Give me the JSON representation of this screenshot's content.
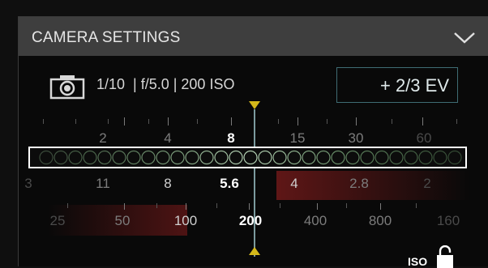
{
  "panel": {
    "title": "CAMERA SETTINGS",
    "collapse_icon": "chevron-down-icon"
  },
  "exposure": {
    "camera_icon": "camera-icon",
    "summary": "1/10  | f/5.0 | 200 ISO",
    "ev_value": "+ 2/3 EV"
  },
  "shutter_scale": {
    "labels": [
      "2",
      "4",
      "8",
      "15",
      "30",
      "60"
    ],
    "selected": "8"
  },
  "aperture_scale": {
    "labels": [
      "11",
      "8",
      "5.6",
      "4",
      "2.8",
      "2"
    ],
    "selected": "5.6"
  },
  "iso_scale": {
    "labels": [
      "25",
      "50",
      "100",
      "200",
      "400",
      "800",
      "160"
    ],
    "selected": "200"
  },
  "iso_lock": {
    "label": "ISO",
    "icon": "lock-icon"
  },
  "colors": {
    "accent_marker": "#d4b81a",
    "ev_box_border": "#3f6c74",
    "header_bg": "#3e3e3e"
  }
}
